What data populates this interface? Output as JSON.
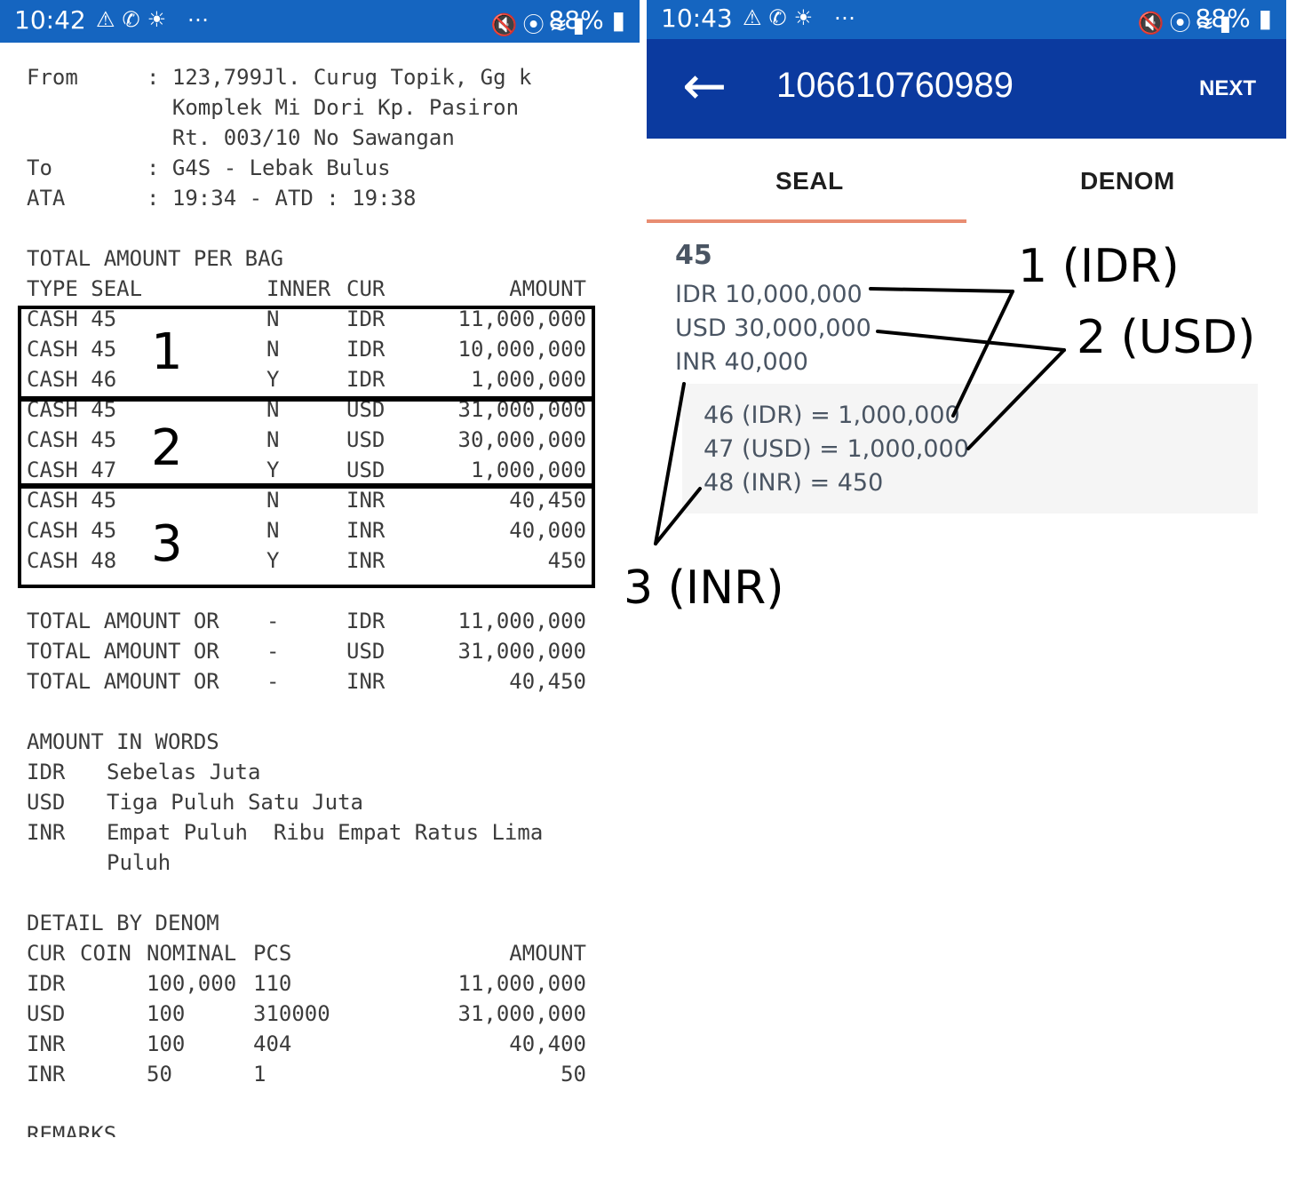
{
  "status_left": {
    "time": "10:42",
    "battery": "88%"
  },
  "status_right": {
    "time": "10:43",
    "battery": "88%"
  },
  "receipt": {
    "from_label": "From",
    "from_value_1": ": 123,799Jl. Curug Topik, Gg k",
    "from_value_2": "  Komplek Mi Dori Kp. Pasiron",
    "from_value_3": "  Rt. 003/10 No Sawangan",
    "to_label": "To",
    "to_value": ": G4S - Lebak Bulus",
    "ata_label": "ATA",
    "ata_value": ": 19:34 - ATD : 19:38",
    "section_bag": "TOTAL AMOUNT PER BAG",
    "bag_header": {
      "type_seal": "TYPE SEAL",
      "inner": "INNER",
      "cur": "CUR",
      "amount": "AMOUNT"
    },
    "bag_rows": [
      {
        "type": "CASH 45",
        "inner": "N",
        "cur": "IDR",
        "amount": "11,000,000"
      },
      {
        "type": "CASH 45",
        "inner": "N",
        "cur": "IDR",
        "amount": "10,000,000"
      },
      {
        "type": "CASH 46",
        "inner": "Y",
        "cur": "IDR",
        "amount": "1,000,000"
      },
      {
        "type": "CASH 45",
        "inner": "N",
        "cur": "USD",
        "amount": "31,000,000"
      },
      {
        "type": "CASH 45",
        "inner": "N",
        "cur": "USD",
        "amount": "30,000,000"
      },
      {
        "type": "CASH 47",
        "inner": "Y",
        "cur": "USD",
        "amount": "1,000,000"
      },
      {
        "type": "CASH 45",
        "inner": "N",
        "cur": "INR",
        "amount": "40,450"
      },
      {
        "type": "CASH 45",
        "inner": "N",
        "cur": "INR",
        "amount": "40,000"
      },
      {
        "type": "CASH 48",
        "inner": "Y",
        "cur": "INR",
        "amount": "450"
      }
    ],
    "group_labels": [
      "1",
      "2",
      "3"
    ],
    "totals": [
      {
        "label": "TOTAL AMOUNT OR",
        "dash": "-",
        "cur": "IDR",
        "amount": "11,000,000"
      },
      {
        "label": "TOTAL AMOUNT OR",
        "dash": "-",
        "cur": "USD",
        "amount": "31,000,000"
      },
      {
        "label": "TOTAL AMOUNT OR",
        "dash": "-",
        "cur": "INR",
        "amount": "40,450"
      }
    ],
    "section_words": "AMOUNT IN WORDS",
    "words": [
      {
        "cur": "IDR",
        "text": "Sebelas Juta"
      },
      {
        "cur": "USD",
        "text": "Tiga Puluh Satu Juta"
      },
      {
        "cur": "INR",
        "text": "Empat Puluh  Ribu Empat Ratus Lima"
      }
    ],
    "words_cont": "Puluh",
    "section_denom": "DETAIL BY DENOM",
    "denom_header": {
      "cur": "CUR",
      "coin": "COIN",
      "nominal": "NOMINAL",
      "pcs": "PCS",
      "amount": "AMOUNT"
    },
    "denom_rows": [
      {
        "cur": "IDR",
        "nominal": "100,000",
        "pcs": "110",
        "amount": "11,000,000"
      },
      {
        "cur": "USD",
        "nominal": "100",
        "pcs": "310000",
        "amount": "31,000,000"
      },
      {
        "cur": "INR",
        "nominal": "100",
        "pcs": "404",
        "amount": "40,400"
      },
      {
        "cur": "INR",
        "nominal": "50",
        "pcs": "1",
        "amount": "50"
      }
    ],
    "section_remarks": "REMARKS"
  },
  "appbar": {
    "title": "106610760989",
    "next": "NEXT"
  },
  "tabs": {
    "seal": "SEAL",
    "denom": "DENOM"
  },
  "seal_panel": {
    "seal_number": "45",
    "rows": [
      "IDR 10,000,000",
      "USD 30,000,000",
      "INR 40,000"
    ],
    "sub_rows": [
      "46 (IDR) = 1,000,000",
      "47 (USD) = 1,000,000",
      "48 (INR) = 450"
    ]
  },
  "annotations": {
    "a1": "1 (IDR)",
    "a2": "2 (USD)",
    "a3": "3 (INR)"
  }
}
